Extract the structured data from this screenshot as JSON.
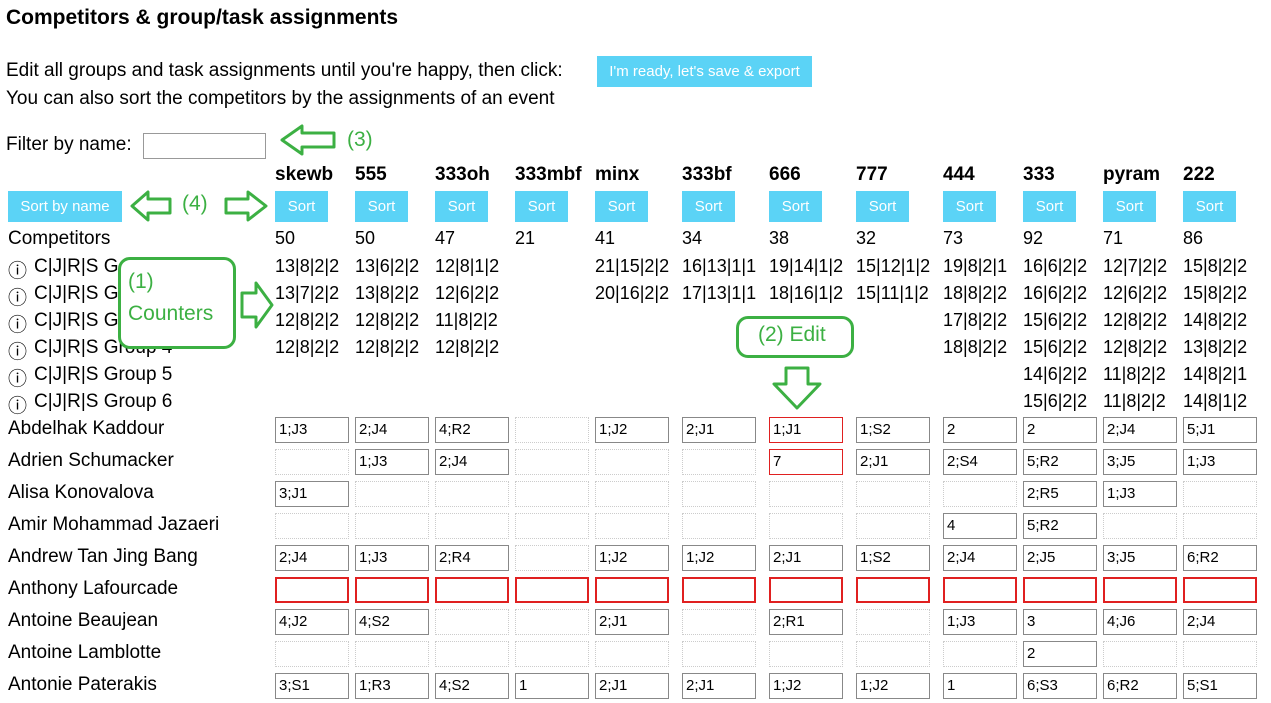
{
  "page": {
    "title": "Competitors & group/task assignments",
    "line1": "Edit all groups and task assignments until you're happy, then click:",
    "line2": "You can also sort the competitors by the assignments of an event",
    "save_button": "I'm ready, let's save & export",
    "filter_label": "Filter by name:",
    "filter_value": "",
    "sort_by_name": "Sort by name",
    "sort_label": "Sort"
  },
  "events": [
    "skewb",
    "555",
    "333oh",
    "333mbf",
    "minx",
    "333bf",
    "666",
    "777",
    "444",
    "333",
    "pyram",
    "222"
  ],
  "competitors_label": "Competitors",
  "competitor_counts": [
    "50",
    "50",
    "47",
    "21",
    "41",
    "34",
    "38",
    "32",
    "73",
    "92",
    "71",
    "86"
  ],
  "group_rows": [
    {
      "icon": "ⓘ",
      "label": "C|J|R|S G",
      "values": [
        "13|8|2|2",
        "13|6|2|2",
        "12|8|1|2",
        "",
        "21|15|2|2",
        "16|13|1|1",
        "19|14|1|2",
        "15|12|1|2",
        "19|8|2|1",
        "16|6|2|2",
        "12|7|2|2",
        "15|8|2|2"
      ]
    },
    {
      "icon": "ⓘ",
      "label": "C|J|R|S G",
      "values": [
        "13|7|2|2",
        "13|8|2|2",
        "12|6|2|2",
        "",
        "20|16|2|2",
        "17|13|1|1",
        "18|16|1|2",
        "15|11|1|2",
        "18|8|2|2",
        "16|6|2|2",
        "12|6|2|2",
        "15|8|2|2"
      ]
    },
    {
      "icon": "ⓘ",
      "label": "C|J|R|S G",
      "values": [
        "12|8|2|2",
        "12|8|2|2",
        "11|8|2|2",
        "",
        "",
        "",
        "",
        "",
        "17|8|2|2",
        "15|6|2|2",
        "12|8|2|2",
        "14|8|2|2"
      ]
    },
    {
      "icon": "ⓘ",
      "label": "C|J|R|S Group 4",
      "values": [
        "12|8|2|2",
        "12|8|2|2",
        "12|8|2|2",
        "",
        "",
        "",
        "",
        "",
        "18|8|2|2",
        "15|6|2|2",
        "12|8|2|2",
        "13|8|2|2"
      ]
    },
    {
      "icon": "ⓘ",
      "label": "C|J|R|S Group 5",
      "values": [
        "",
        "",
        "",
        "",
        "",
        "",
        "",
        "",
        "",
        "14|6|2|2",
        "11|8|2|2",
        "14|8|2|1"
      ]
    },
    {
      "icon": "ⓘ",
      "label": "C|J|R|S Group 6",
      "values": [
        "",
        "",
        "",
        "",
        "",
        "",
        "",
        "",
        "",
        "15|6|2|2",
        "11|8|2|2",
        "14|8|1|2"
      ]
    }
  ],
  "competitors": [
    {
      "name": "Abdelhak Kaddour",
      "cells": [
        "1;J3",
        "2;J4",
        "4;R2",
        "",
        "1;J2",
        "2;J1",
        "1;J1",
        "1;S2",
        "2",
        "2",
        "2;J4",
        "5;J1"
      ]
    },
    {
      "name": "Adrien Schumacker",
      "cells": [
        "",
        "1;J3",
        "2;J4",
        "",
        "",
        "",
        "7",
        "2;J1",
        "2;S4",
        "5;R2",
        "3;J5",
        "1;J3"
      ]
    },
    {
      "name": "Alisa Konovalova",
      "cells": [
        "3;J1",
        "",
        "",
        "",
        "",
        "",
        "",
        "",
        "",
        "2;R5",
        "1;J3",
        ""
      ]
    },
    {
      "name": "Amir Mohammad Jazaeri",
      "cells": [
        "",
        "",
        "",
        "",
        "",
        "",
        "",
        "",
        "4",
        "5;R2",
        "",
        ""
      ]
    },
    {
      "name": "Andrew Tan Jing Bang",
      "cells": [
        "2;J4",
        "1;J3",
        "2;R4",
        "",
        "1;J2",
        "1;J2",
        "2;J1",
        "1;S2",
        "2;J4",
        "2;J5",
        "3;J5",
        "6;R2"
      ]
    },
    {
      "name": "Anthony Lafourcade",
      "cells": [
        "",
        "",
        "",
        "",
        "",
        "",
        "",
        "",
        "",
        "",
        "",
        ""
      ]
    },
    {
      "name": "Antoine Beaujean",
      "cells": [
        "4;J2",
        "4;S2",
        "",
        "",
        "2;J1",
        "",
        "2;R1",
        "",
        "1;J3",
        "3",
        "4;J6",
        "2;J4"
      ]
    },
    {
      "name": "Antoine Lamblotte",
      "cells": [
        "",
        "",
        "",
        "",
        "",
        "",
        "",
        "",
        "",
        "2",
        "",
        ""
      ]
    },
    {
      "name": "Antonie Paterakis",
      "cells": [
        "3;S1",
        "1;R3",
        "4;S2",
        "1",
        "2;J1",
        "2;J1",
        "1;J2",
        "1;J2",
        "1",
        "6;S3",
        "6;R2",
        "5;S1"
      ]
    }
  ],
  "annotations": {
    "a1_line1": "(1)",
    "a1_line2": "Counters",
    "a2": "(2) Edit",
    "a3": "(3)",
    "a4": "(4)"
  },
  "colors": {
    "accent": "#5bd3f6",
    "annotation": "#3cb043",
    "error": "#e02020"
  }
}
